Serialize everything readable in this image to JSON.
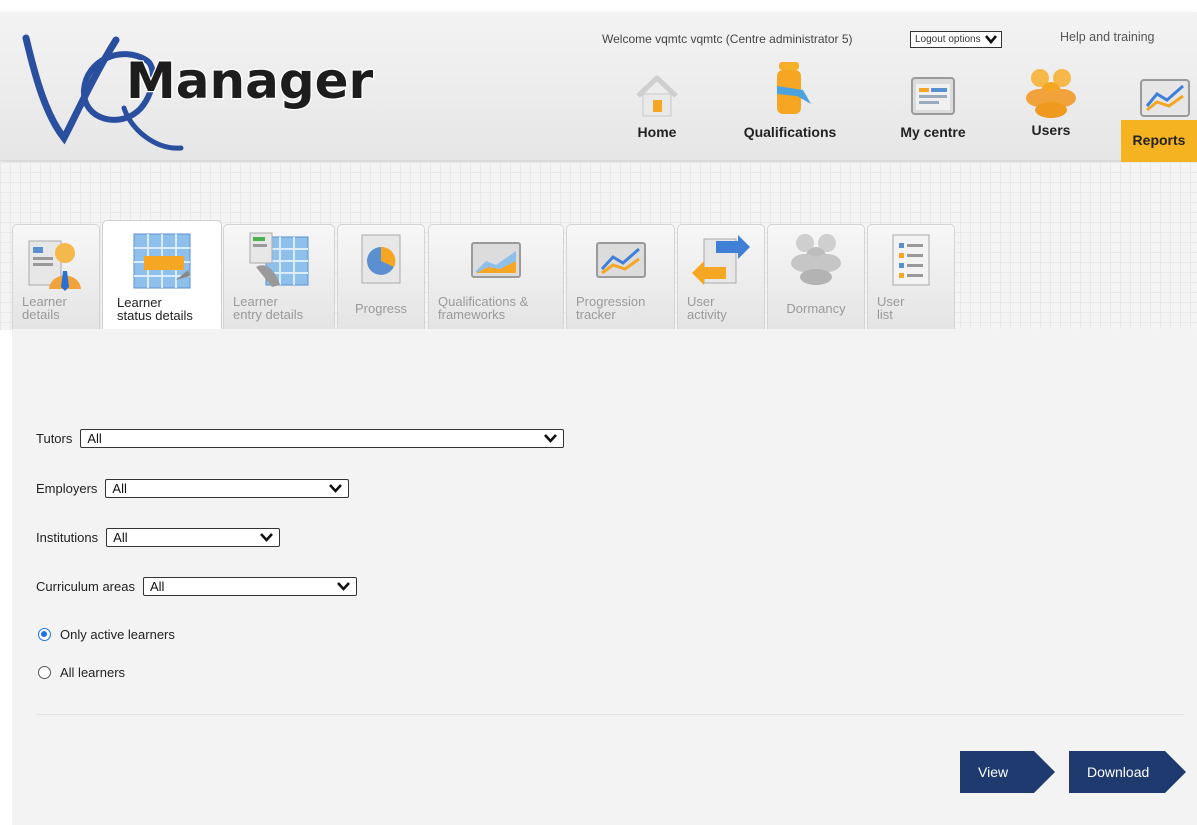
{
  "header": {
    "logo_text_vq": "VQ",
    "logo_text_manager": "Manager",
    "welcome": "Welcome vqmtc vqmtc (Centre administrator 5)",
    "logout_label": "Logout options",
    "help_label": "Help and training"
  },
  "nav": {
    "home": "Home",
    "qualifications": "Qualifications",
    "my_centre": "My centre",
    "users": "Users",
    "reports": "Reports",
    "active": "Reports"
  },
  "report_tabs": {
    "learner_details": [
      "Learner",
      "details"
    ],
    "learner_status_details": [
      "Learner",
      "status details"
    ],
    "learner_entry_details": [
      "Learner",
      "entry details"
    ],
    "progress": "Progress",
    "qualifications_frameworks": [
      "Qualifications &",
      "frameworks"
    ],
    "progression_tracker": [
      "Progression",
      "tracker"
    ],
    "user_activity": [
      "User",
      "activity"
    ],
    "dormancy": "Dormancy",
    "user_list": [
      "User",
      "list"
    ],
    "active": "Learner status details"
  },
  "filters": {
    "tutors": {
      "label": "Tutors",
      "value": "All"
    },
    "employers": {
      "label": "Employers",
      "value": "All"
    },
    "institutions": {
      "label": "Institutions",
      "value": "All"
    },
    "curriculum_areas": {
      "label": "Curriculum areas",
      "value": "All"
    }
  },
  "learner_scope": {
    "options": [
      "Only active learners",
      "All learners"
    ],
    "selected": "Only active learners"
  },
  "actions": {
    "view": "View",
    "download": "Download"
  },
  "colors": {
    "accent": "#f5b321",
    "button": "#1e3a6e",
    "logo_blue": "#2a4f9e"
  }
}
